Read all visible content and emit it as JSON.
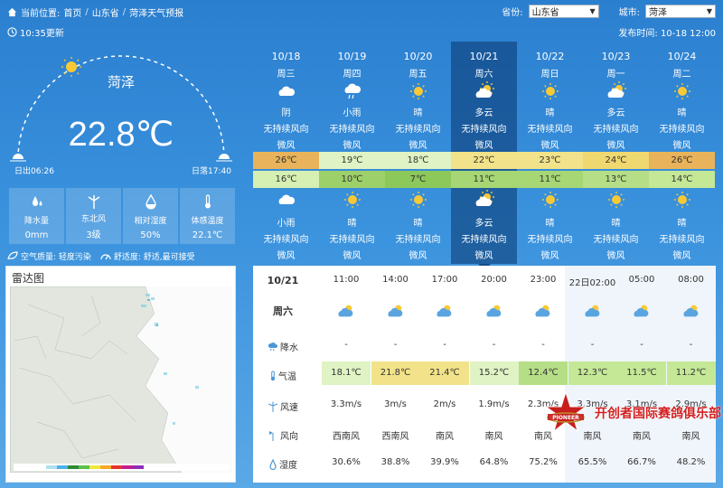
{
  "breadcrumb": {
    "location_label": "当前位置:",
    "items": [
      "首页",
      "山东省",
      "菏泽天气预报"
    ]
  },
  "selectors": {
    "province_label": "省份:",
    "province_value": "山东省",
    "city_label": "城市:",
    "city_value": "菏泽"
  },
  "subbar": {
    "updated": "10:35更新",
    "published": "发布时间: 10-18 12:00"
  },
  "current": {
    "city": "菏泽",
    "temperature": "22.8℃",
    "sunrise": "日出06:26",
    "sunset": "日落17:40"
  },
  "indices": [
    {
      "icon": "raindrop-icon",
      "label": "降水量",
      "value": "0mm"
    },
    {
      "icon": "wind-turbine-icon",
      "label": "东北风",
      "value": "3级"
    },
    {
      "icon": "humidity-icon",
      "label": "相对湿度",
      "value": "50%"
    },
    {
      "icon": "thermometer-icon",
      "label": "体感温度",
      "value": "22.1℃"
    }
  ],
  "air_quality": {
    "aq_label": "空气质量: 轻度污染",
    "comfort_label": "舒适度: 舒适,最可接受"
  },
  "radar": {
    "title": "雷达图"
  },
  "forecast": [
    {
      "date": "10/18",
      "week": "周三",
      "icon1": "overcast",
      "cond1": "阴",
      "wind1": "无持续风向",
      "level1": "微风",
      "high": "26℃",
      "high_color": "#e8b35a",
      "low": "16℃",
      "low_color": "#d6efb2",
      "icon2": "cloudy-night",
      "cond2": "小雨",
      "wind2": "无持续风向",
      "level2": "微风"
    },
    {
      "date": "10/19",
      "week": "周四",
      "icon1": "light-rain",
      "cond1": "小雨",
      "wind1": "无持续风向",
      "level1": "微风",
      "high": "19℃",
      "high_color": "#dff3c4",
      "low": "10℃",
      "low_color": "#9ed06a",
      "icon2": "sunny",
      "cond2": "晴",
      "wind2": "无持续风向",
      "level2": "微风"
    },
    {
      "date": "10/20",
      "week": "周五",
      "icon1": "sunny",
      "cond1": "晴",
      "wind1": "无持续风向",
      "level1": "微风",
      "high": "18℃",
      "high_color": "#dff3c4",
      "low": "7℃",
      "low_color": "#8cc85a",
      "icon2": "sunny",
      "cond2": "晴",
      "wind2": "无持续风向",
      "level2": "微风"
    },
    {
      "date": "10/21",
      "week": "周六",
      "icon1": "partly-cloudy",
      "cond1": "多云",
      "wind1": "无持续风向",
      "level1": "微风",
      "high": "22℃",
      "high_color": "#f2e38a",
      "low": "11℃",
      "low_color": "#a6d774",
      "icon2": "partly-cloudy",
      "cond2": "多云",
      "wind2": "无持续风向",
      "level2": "微风"
    },
    {
      "date": "10/22",
      "week": "周日",
      "icon1": "sunny",
      "cond1": "晴",
      "wind1": "无持续风向",
      "level1": "微风",
      "high": "23℃",
      "high_color": "#f2e38a",
      "low": "11℃",
      "low_color": "#a6d774",
      "icon2": "sunny",
      "cond2": "晴",
      "wind2": "无持续风向",
      "level2": "微风"
    },
    {
      "date": "10/23",
      "week": "周一",
      "icon1": "partly-cloudy",
      "cond1": "多云",
      "wind1": "无持续风向",
      "level1": "微风",
      "high": "24℃",
      "high_color": "#f0d870",
      "low": "13℃",
      "low_color": "#b6de86",
      "icon2": "sunny",
      "cond2": "晴",
      "wind2": "无持续风向",
      "level2": "微风"
    },
    {
      "date": "10/24",
      "week": "周二",
      "icon1": "sunny",
      "cond1": "晴",
      "wind1": "无持续风向",
      "level1": "微风",
      "high": "26℃",
      "high_color": "#e8b35a",
      "low": "14℃",
      "low_color": "#c4e896",
      "icon2": "sunny",
      "cond2": "晴",
      "wind2": "无持续风向",
      "level2": "微风"
    }
  ],
  "hourly": {
    "date": "10/21",
    "week": "周六",
    "row_labels": {
      "precip": "降水",
      "temp": "气温",
      "windspeed": "风速",
      "winddir": "风向",
      "humidity": "湿度"
    },
    "columns": [
      {
        "time": "11:00",
        "icon": "partly-cloudy",
        "precip": "-",
        "temp": "18.1℃",
        "temp_color": "#dff3c4",
        "windspeed": "3.3m/s",
        "winddir": "西南风",
        "humidity": "30.6%"
      },
      {
        "time": "14:00",
        "icon": "partly-cloudy",
        "precip": "-",
        "temp": "21.8℃",
        "temp_color": "#f2e38a",
        "windspeed": "3m/s",
        "winddir": "西南风",
        "humidity": "38.8%"
      },
      {
        "time": "17:00",
        "icon": "partly-cloudy",
        "precip": "-",
        "temp": "21.4℃",
        "temp_color": "#f2e38a",
        "windspeed": "2m/s",
        "winddir": "南风",
        "humidity": "39.9%"
      },
      {
        "time": "20:00",
        "icon": "partly-cloudy",
        "precip": "-",
        "temp": "15.2℃",
        "temp_color": "#dff3c4",
        "windspeed": "1.9m/s",
        "winddir": "南风",
        "humidity": "64.8%"
      },
      {
        "time": "23:00",
        "icon": "partly-cloudy",
        "precip": "-",
        "temp": "12.4℃",
        "temp_color": "#b6de86",
        "windspeed": "2.3m/s",
        "winddir": "南风",
        "humidity": "75.2%"
      },
      {
        "time": "22日02:00",
        "icon": "partly-cloudy",
        "precip": "-",
        "temp": "12.3℃",
        "temp_color": "#c4e896",
        "windspeed": "3.3m/s",
        "winddir": "南风",
        "humidity": "65.5%"
      },
      {
        "time": "05:00",
        "icon": "partly-cloudy",
        "precip": "-",
        "temp": "11.5℃",
        "temp_color": "#c4e896",
        "windspeed": "3.1m/s",
        "winddir": "南风",
        "humidity": "66.7%"
      },
      {
        "time": "08:00",
        "icon": "partly-cloudy",
        "precip": "-",
        "temp": "11.2℃",
        "temp_color": "#c4e896",
        "windspeed": "2.9m/s",
        "winddir": "南风",
        "humidity": "48.2%"
      }
    ]
  },
  "watermark": {
    "text": "开创者国际赛鸽俱乐部",
    "emblem_text": "PIONEER"
  }
}
